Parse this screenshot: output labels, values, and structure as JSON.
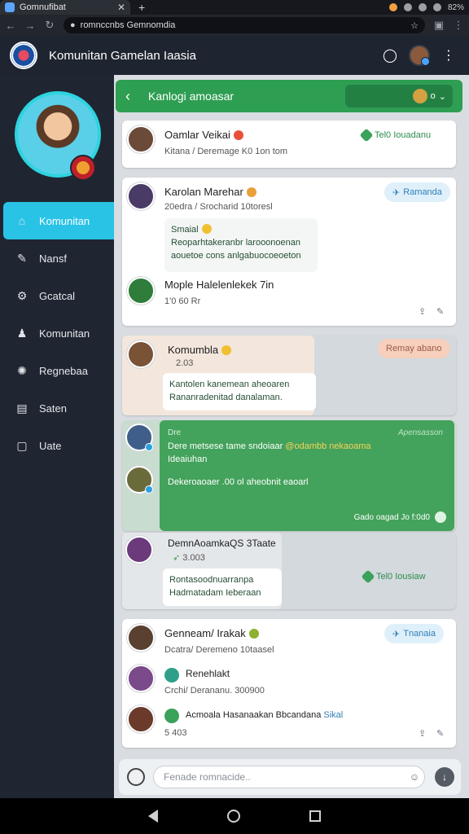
{
  "browser": {
    "tab_title": "Gomnufibat",
    "url": "romnccnbs Gemnomdia",
    "status_text": "82%"
  },
  "app": {
    "title": "Komunitan Gamelan Iaasia"
  },
  "sidebar": {
    "items": [
      {
        "label": "Komunitan",
        "icon": "community-icon"
      },
      {
        "label": "Nansf",
        "icon": "pencil-icon"
      },
      {
        "label": "Gcatcal",
        "icon": "gear-icon"
      },
      {
        "label": "Komunitan",
        "icon": "person-icon"
      },
      {
        "label": "Regnebaa",
        "icon": "settings-icon"
      },
      {
        "label": "Saten",
        "icon": "folder-icon"
      },
      {
        "label": "Uate",
        "icon": "document-icon"
      }
    ]
  },
  "group": {
    "title": "Kanlogi amoasar",
    "select_value": "o"
  },
  "posts": [
    {
      "name": "Oamlar Veikai",
      "meta": "Kitana / Deremage K0 1on tom",
      "action": "Tel0 Iouadanu"
    },
    {
      "name": "Karolan Marehar",
      "meta": "20edra / Srocharid 10toresl",
      "pill": "Ramanda",
      "bubble_title": "Smaial",
      "bubble_lines": [
        "Reoparhtakeranbr larooonoenan",
        "aouetoe cons anlgabuocoeoeton"
      ],
      "reply_name": "Mople Halelenlekek 7in",
      "reactions": "1'0 60 Rr"
    },
    {
      "name": "Komumbla",
      "meta": "2.03",
      "pill": "Remay abano",
      "bubble_lines": [
        "Kantolen kanemean aheoaren",
        "Rananradenitad danalaman."
      ]
    },
    {
      "label": "Dre",
      "label_right": "Apensasson",
      "text1": "Dere metsese tame sndoiaar",
      "text1_highlight": "@odambb nekaoama",
      "text2": "Ideaiuhan",
      "text3": "Dekeroaoaer .00 ol aheobnit eaoarl",
      "footer": "Gado oagad Jo f:0d0"
    },
    {
      "name": "DemnAoamkaQS 3Taate",
      "meta": "3.003",
      "bubble_lines": [
        "Rontasoodnuarranpa",
        "Hadmatadam Ieberaan"
      ],
      "action": "Tel0 Iousiaw"
    },
    {
      "name": "Genneam/ Irakak",
      "meta": "Dcatra/ Deremeno 10taasel",
      "pill": "Tnanaia",
      "reply1_name": "Renehlakt",
      "reply1_meta": "Crchi/ Derananu. 300900",
      "reply2_name": "Acmoala Hasanaakan Bbcandana",
      "reply2_tag": "Sikal",
      "reply2_meta": "5 403"
    }
  ],
  "composer": {
    "placeholder": "Fenade romnacide.."
  }
}
